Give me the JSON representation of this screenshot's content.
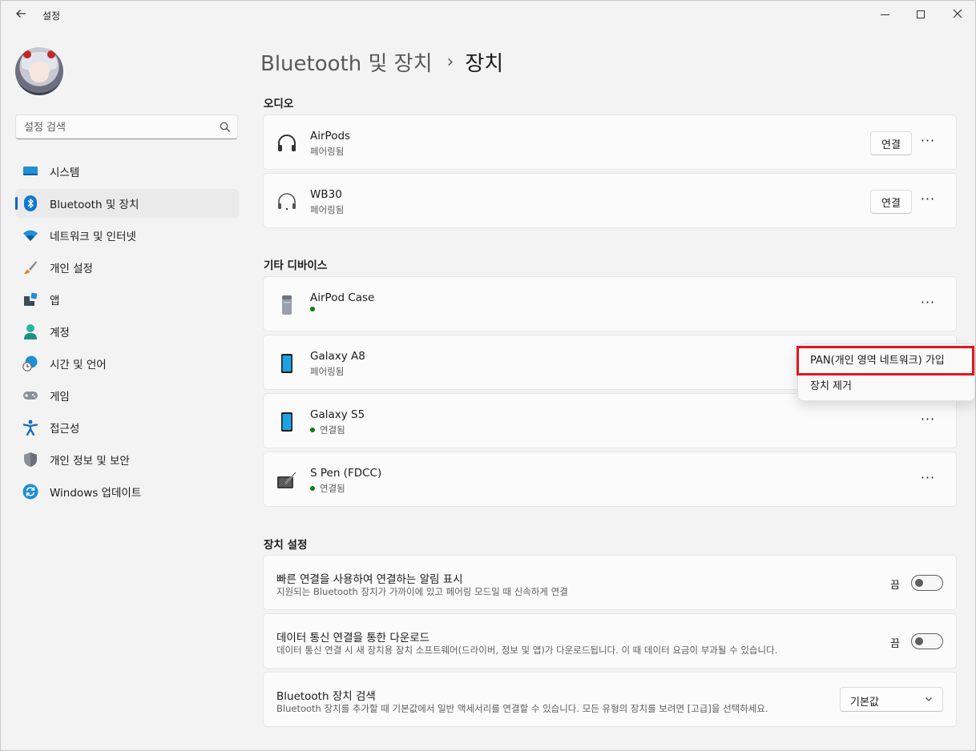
{
  "window": {
    "title": "설정",
    "back_icon": "back-arrow-icon",
    "minimize_icon": "minimize-icon",
    "maximize_icon": "maximize-icon",
    "close_icon": "close-icon"
  },
  "sidebar": {
    "search_placeholder": "설정 검색",
    "items": [
      {
        "label": "시스템",
        "icon": "system-monitor-icon",
        "active": false
      },
      {
        "label": "Bluetooth 및 장치",
        "icon": "bluetooth-icon",
        "active": true
      },
      {
        "label": "네트워크 및 인터넷",
        "icon": "wifi-icon",
        "active": false
      },
      {
        "label": "개인 설정",
        "icon": "brush-icon",
        "active": false
      },
      {
        "label": "앱",
        "icon": "apps-icon",
        "active": false
      },
      {
        "label": "계정",
        "icon": "account-icon",
        "active": false
      },
      {
        "label": "시간 및 언어",
        "icon": "globe-clock-icon",
        "active": false
      },
      {
        "label": "게임",
        "icon": "gamepad-icon",
        "active": false
      },
      {
        "label": "접근성",
        "icon": "accessibility-icon",
        "active": false
      },
      {
        "label": "개인 정보 및 보안",
        "icon": "shield-icon",
        "active": false
      },
      {
        "label": "Windows 업데이트",
        "icon": "update-icon",
        "active": false
      }
    ]
  },
  "breadcrumb": {
    "parent": "Bluetooth 및 장치",
    "separator": "›",
    "current": "장치"
  },
  "audio": {
    "title": "오디오",
    "devices": [
      {
        "name": "AirPods",
        "status": "페어링됨",
        "button": "연결",
        "more": "···"
      },
      {
        "name": "WB30",
        "status": "페어링됨",
        "button": "연결",
        "more": "···"
      }
    ]
  },
  "other": {
    "title": "기타 디바이스",
    "devices": [
      {
        "name": "AirPod Case",
        "status": "",
        "more": "···"
      },
      {
        "name": "Galaxy A8",
        "status": "페어링됨",
        "more": "···"
      },
      {
        "name": "Galaxy S5",
        "status": "연결됨",
        "more": "···"
      },
      {
        "name": "S Pen (FDCC)",
        "status": "연결됨",
        "more": "···"
      }
    ]
  },
  "context_menu": {
    "items": [
      "PAN(개인 영역 네트워크) 가입",
      "장치 제거"
    ],
    "highlight_color": "#e3161d"
  },
  "device_settings": {
    "title": "장치 설정",
    "swift_pair": {
      "title": "빠른 연결을 사용하여 연결하는 알림 표시",
      "desc": "지원되는 Bluetooth 장치가 가까이에 있고 페어링 모드일 때 신속하게 연결",
      "toggle_label": "끔",
      "on": false
    },
    "metered": {
      "title": "데이터 통신 연결을 통한 다운로드",
      "desc": "데이터 통신 연결 시 새 장치용 장치 소프트웨어(드라이버, 정보 및 앱)가 다운로드됩니다. 이 때 데이터 요금이 부과될 수 있습니다.",
      "toggle_label": "끔",
      "on": false
    },
    "discovery": {
      "title": "Bluetooth 장치 검색",
      "desc": "Bluetooth 장치를 추가할 때 기본값에서 일반 액세서리를 연결할 수 있습니다. 모든 유형의 장치를 보려면 [고급]을 선택하세요.",
      "value": "기본값"
    }
  },
  "colors": {
    "accent": "#0067c0",
    "connected_dot": "#0f7b0f"
  }
}
